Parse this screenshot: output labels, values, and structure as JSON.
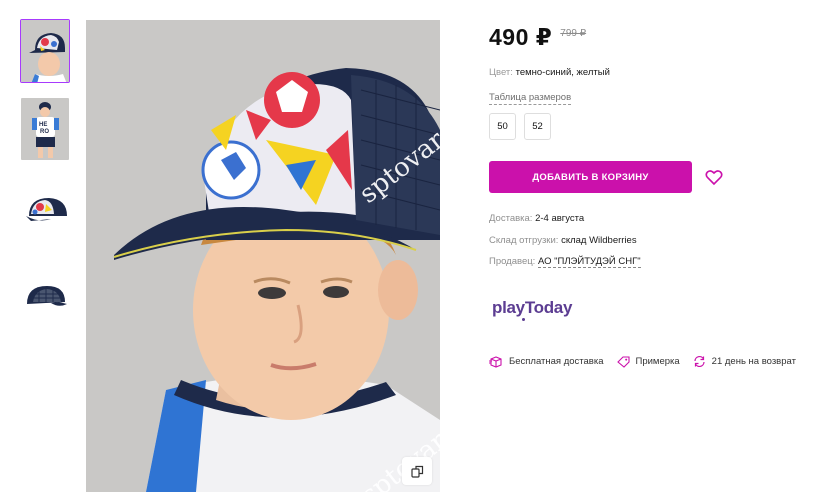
{
  "gallery": {
    "thumbnails": [
      {
        "name": "thumb-boy-cap-front",
        "active": true
      },
      {
        "name": "thumb-boy-full-outfit",
        "active": false
      },
      {
        "name": "thumb-cap-side",
        "active": false
      },
      {
        "name": "thumb-cap-back",
        "active": false
      }
    ],
    "watermark": "sptovarov"
  },
  "product": {
    "price": "490 ₽",
    "old_price": "799 ₽",
    "color_label": "Цвет:",
    "color_value": "темно-синий, желтый",
    "size_table_link": "Таблица размеров",
    "sizes": [
      "50",
      "52"
    ],
    "add_to_cart": "ДОБАВИТЬ В КОРЗИНУ",
    "delivery_label": "Доставка:",
    "delivery_value": "2-4 августа",
    "warehouse_label": "Склад отгрузки:",
    "warehouse_value": "склад Wildberries",
    "seller_label": "Продавец:",
    "seller_value": "АО \"ПЛЭЙТУДЭЙ СНГ\"",
    "brand": "playToday"
  },
  "features": [
    {
      "icon": "box-icon",
      "label": "Бесплатная доставка"
    },
    {
      "icon": "tag-icon",
      "label": "Примерка"
    },
    {
      "icon": "return-arrows-icon",
      "label": "21 день на возврат"
    }
  ],
  "colors": {
    "accent": "#cb11ab",
    "brand": "#5c3d92",
    "active_thumb_border": "#a73afd"
  }
}
